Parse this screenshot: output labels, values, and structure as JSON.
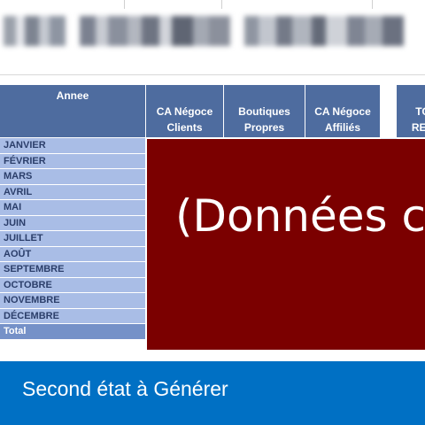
{
  "table": {
    "headers": [
      {
        "label": "Annee"
      },
      {
        "label": "CA Négoce\nClients"
      },
      {
        "label": "Boutiques\nPropres"
      },
      {
        "label": "CA Négoce\nAffiliés"
      },
      {
        "label": "TO\nRED"
      }
    ],
    "months": [
      "JANVIER",
      "FÉVRIER",
      "MARS",
      "AVRIL",
      "MAI",
      "JUIN",
      "JUILLET",
      "AOÛT",
      "SEPTEMBRE",
      "OCTOBRE",
      "NOVEMBRE",
      "DÉCEMBRE"
    ],
    "total_label": "Total"
  },
  "overlay": {
    "text": "(Données c"
  },
  "footer": {
    "title": "Second état à Générer"
  },
  "colors": {
    "header_bg": "#4e6c9f",
    "row_bg": "#a9bde6",
    "overlay_bg": "#7b0000",
    "footer_bg": "#0070c4"
  }
}
